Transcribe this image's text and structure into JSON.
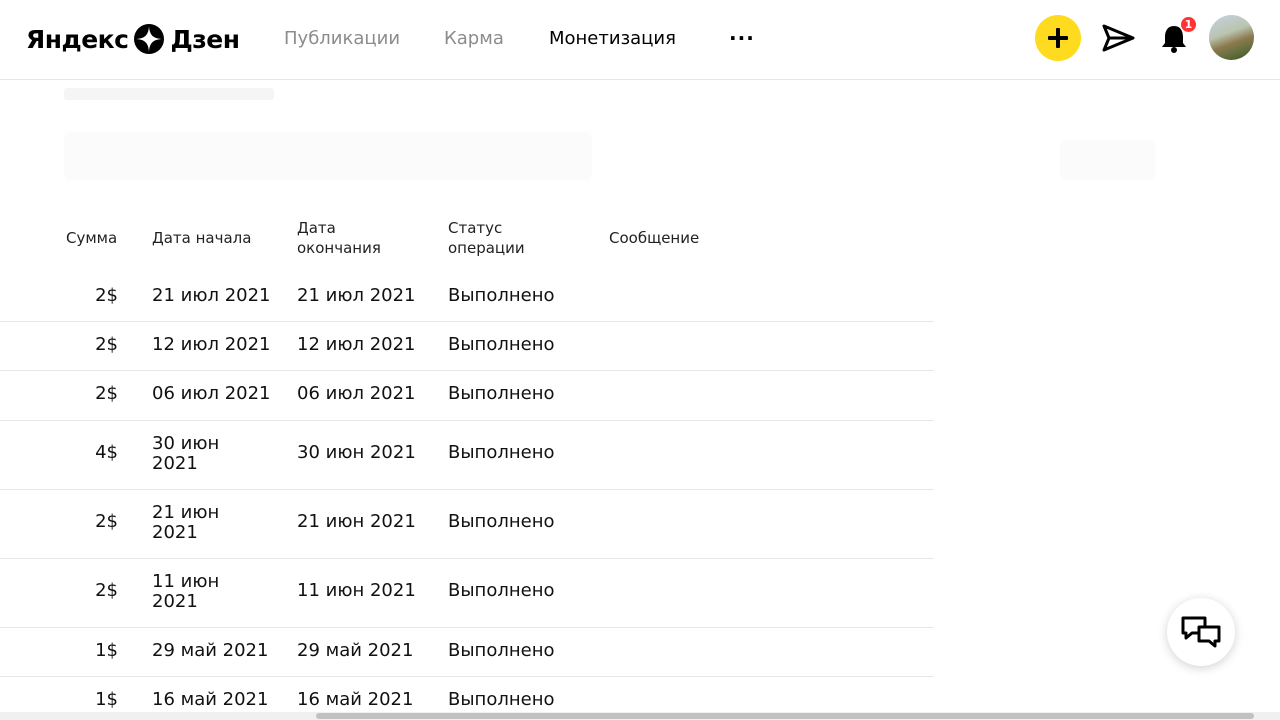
{
  "header": {
    "logo_left": "Яндекс",
    "logo_right": "Дзен",
    "nav": [
      {
        "label": "Публикации"
      },
      {
        "label": "Карма"
      },
      {
        "label": "Монетизация"
      }
    ],
    "more": "···",
    "notifications_count": "1"
  },
  "table": {
    "headers": {
      "sum": "Сумма",
      "start": "Дата начала",
      "end_line1": "Дата",
      "end_line2": "окончания",
      "status_line1": "Статус",
      "status_line2": "операции",
      "message": "Сообщение"
    },
    "rows": [
      {
        "sum": "2$",
        "start": "21 июл 2021",
        "start2": "",
        "end": "21 июл 2021",
        "status": "Выполнено"
      },
      {
        "sum": "2$",
        "start": "12 июл 2021",
        "start2": "",
        "end": "12 июл 2021",
        "status": "Выполнено"
      },
      {
        "sum": "2$",
        "start": "06 июл 2021",
        "start2": "",
        "end": "06 июл 2021",
        "status": "Выполнено"
      },
      {
        "sum": "4$",
        "start": "30 июн",
        "start2": "2021",
        "end": "30 июн 2021",
        "status": "Выполнено"
      },
      {
        "sum": "2$",
        "start": "21 июн",
        "start2": "2021",
        "end": "21 июн 2021",
        "status": "Выполнено"
      },
      {
        "sum": "2$",
        "start": "11 июн",
        "start2": "2021",
        "end": "11 июн 2021",
        "status": "Выполнено"
      },
      {
        "sum": "1$",
        "start": "29 май 2021",
        "start2": "",
        "end": "29 май 2021",
        "status": "Выполнено"
      },
      {
        "sum": "1$",
        "start": "16 май 2021",
        "start2": "",
        "end": "16 май 2021",
        "status": "Выполнено"
      }
    ]
  },
  "colors": {
    "accent": "#ffdb1f",
    "badge": "#ff3333"
  }
}
